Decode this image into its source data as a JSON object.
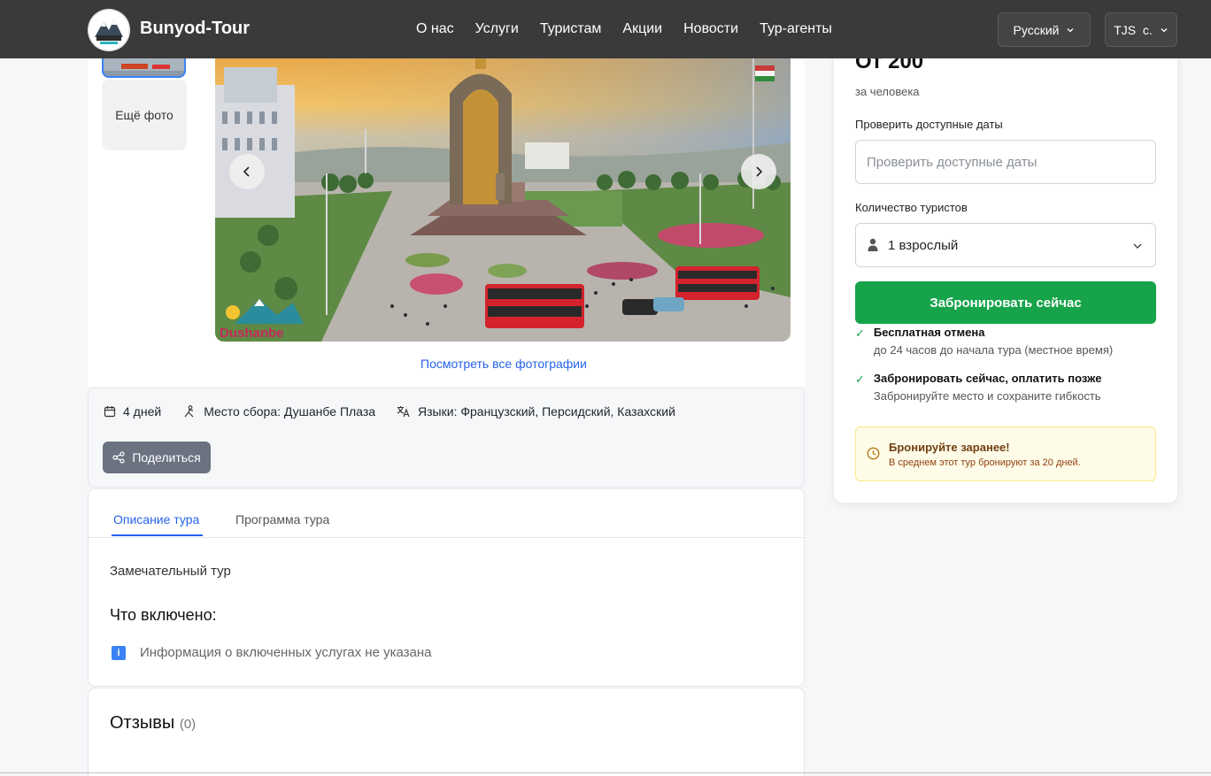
{
  "header": {
    "brand": "Bunyod-Tour",
    "nav": [
      "О нас",
      "Услуги",
      "Туристам",
      "Акции",
      "Новости",
      "Тур-агенты"
    ],
    "language": "Русский",
    "currency": "TJS  с."
  },
  "gallery": {
    "more_photos": "Ещё фото",
    "see_all": "Посмотреть все фотографии",
    "watermark": "Dushanbe"
  },
  "details": {
    "duration": "4 дней",
    "meeting_point": "Место сбора: Душанбе Плаза",
    "languages": "Языки: Французский, Персидский, Казахский",
    "share": "Поделиться"
  },
  "tabs": [
    "Описание тура",
    "Программа тура"
  ],
  "description": {
    "text": "Замечательный тур",
    "included_heading": "Что включено:",
    "included_empty": "Информация о включенных услугах не указана"
  },
  "reviews": {
    "heading": "Отзывы",
    "count": "(0)"
  },
  "booking": {
    "price": "От 200",
    "per_person": "за человека",
    "dates_label": "Проверить доступные даты",
    "dates_placeholder": "Проверить доступные даты",
    "tourists_label": "Количество туристов",
    "tourists_value": "1 взрослый",
    "book_button": "Забронировать сейчас",
    "features": [
      {
        "title": "Бесплатная отмена",
        "subtitle": "до 24 часов до начала тура (местное время)"
      },
      {
        "title": "Забронировать сейчас, оплатить позже",
        "subtitle": "Забронируйте место и сохраните гибкость"
      }
    ],
    "notice_title": "Бронируйте заранее!",
    "notice_text": "В среднем этот тур бронируют за 20 дней."
  },
  "colors": {
    "header_bg": "#3a3a3a",
    "accent_blue": "#2563eb",
    "book_green": "#16a34a"
  }
}
